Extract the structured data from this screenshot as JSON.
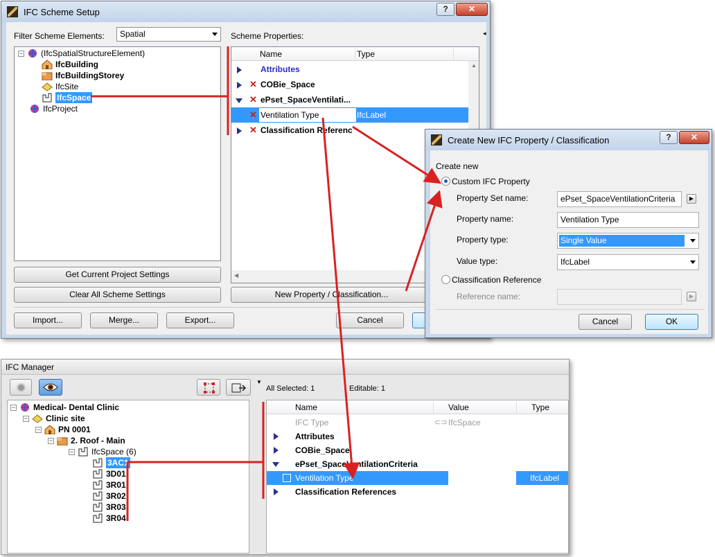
{
  "scheme_window": {
    "title": "IFC Scheme Setup",
    "filter_label": "Filter Scheme Elements:",
    "filter_value": "Spatial",
    "scheme_properties_label": "Scheme Properties:",
    "tree": [
      {
        "label": "(IfcSpatialStructureElement)",
        "bold": false,
        "icon": "spatial-structure-icon"
      },
      {
        "label": "IfcBuilding",
        "bold": true,
        "icon": "building-icon"
      },
      {
        "label": "IfcBuildingStorey",
        "bold": true,
        "icon": "building-storey-icon"
      },
      {
        "label": "IfcSite",
        "bold": false,
        "icon": "site-icon"
      },
      {
        "label": "IfcSpace",
        "bold": true,
        "icon": "space-icon"
      },
      {
        "label": "IfcProject",
        "bold": false,
        "icon": "project-icon"
      }
    ],
    "columns": {
      "name": "Name",
      "type": "Type"
    },
    "properties": [
      {
        "name": "Attributes",
        "type": ""
      },
      {
        "name": "COBie_Space",
        "type": ""
      },
      {
        "name": "ePset_SpaceVentilati...",
        "type": ""
      },
      {
        "name": "Ventilation Type",
        "type": "IfcLabel"
      },
      {
        "name": "Classification Referenc",
        "type": ""
      }
    ],
    "buttons": {
      "get_current": "Get Current Project Settings",
      "clear_all": "Clear All Scheme Settings",
      "new_property": "New Property / Classification...",
      "import": "Import...",
      "merge": "Merge...",
      "export": "Export...",
      "cancel": "Cancel"
    }
  },
  "create_dialog": {
    "title": "Create New IFC Property / Classification",
    "create_new_label": "Create new",
    "custom_property_label": "Custom IFC Property",
    "property_set_label": "Property Set name:",
    "property_set_value": "ePset_SpaceVentilationCriteria",
    "property_name_label": "Property name:",
    "property_name_value": "Ventilation Type",
    "property_type_label": "Property type:",
    "property_type_value": "Single Value",
    "value_type_label": "Value type:",
    "value_type_value": "IfcLabel",
    "classification_label": "Classification Reference",
    "reference_name_label": "Reference name:",
    "reference_name_value": "",
    "cancel": "Cancel",
    "ok": "OK"
  },
  "manager_window": {
    "title": "IFC Manager",
    "all_selected": "All Selected: 1",
    "editable": "Editable: 1",
    "tree": [
      {
        "label": "Medical- Dental Clinic",
        "bold": true
      },
      {
        "label": "Clinic site",
        "bold": true
      },
      {
        "label": "PN 0001",
        "bold": true
      },
      {
        "label": "2. Roof - Main",
        "bold": true
      },
      {
        "label": "IfcSpace (6)",
        "bold": false
      },
      {
        "label": "3AC1",
        "bold": true
      },
      {
        "label": "3D01",
        "bold": true
      },
      {
        "label": "3R01",
        "bold": true
      },
      {
        "label": "3R02",
        "bold": true
      },
      {
        "label": "3R03",
        "bold": true
      },
      {
        "label": "3R04",
        "bold": true
      }
    ],
    "columns": {
      "name": "Name",
      "value": "Value",
      "type": "Type"
    },
    "ifc_type_row": {
      "name": "IFC Type",
      "value": "IfcSpace"
    },
    "properties": [
      {
        "name": "Attributes",
        "value": "",
        "type": ""
      },
      {
        "name": "COBie_Space",
        "value": "",
        "type": ""
      },
      {
        "name": "ePset_SpaceVentilationCriteria",
        "value": "",
        "type": ""
      },
      {
        "name": "Ventilation Type",
        "value": "",
        "type": "IfcLabel"
      },
      {
        "name": "Classification References",
        "value": "",
        "type": ""
      }
    ]
  },
  "colors": {
    "selection": "#3399ff",
    "annotation_red": "#d92121",
    "title_blue": "#c3d4e8"
  }
}
